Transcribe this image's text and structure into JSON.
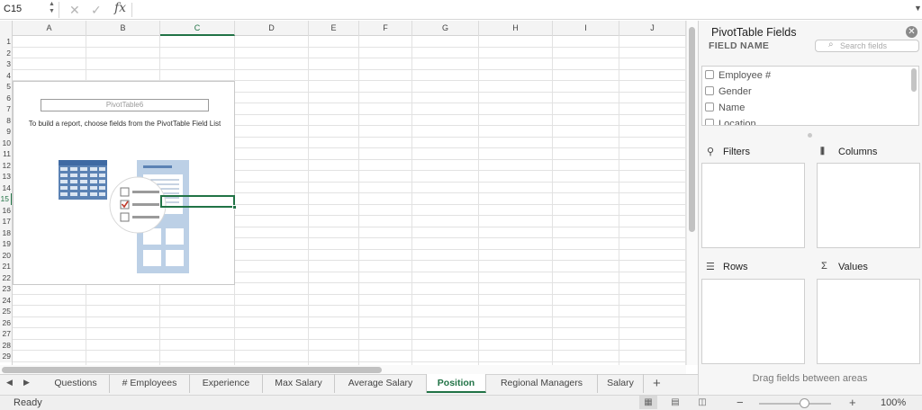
{
  "formula_bar": {
    "name_box": "C15",
    "fx": "fx"
  },
  "grid": {
    "columns": [
      "A",
      "B",
      "C",
      "D",
      "E",
      "F",
      "G",
      "H",
      "I",
      "J"
    ],
    "active_column": "C",
    "rows": [
      "1",
      "2",
      "3",
      "4",
      "5",
      "6",
      "7",
      "8",
      "9",
      "10",
      "11",
      "12",
      "13",
      "14",
      "15",
      "16",
      "17",
      "18",
      "19",
      "20",
      "21",
      "22",
      "23",
      "24",
      "25",
      "26",
      "27",
      "28",
      "29"
    ],
    "active_row": "15"
  },
  "pivot_placeholder": {
    "name": "PivotTable6",
    "message": "To build a report, choose fields from the PivotTable Field List"
  },
  "sheet_tabs": [
    "Questions",
    "# Employees",
    "Experience",
    "Max Salary",
    "Average Salary",
    "Position",
    "Regional Managers",
    "Salary"
  ],
  "active_sheet": "Position",
  "status_bar": {
    "status": "Ready",
    "zoom": "100%",
    "zoom_percent": 100
  },
  "field_pane": {
    "title": "PivotTable Fields",
    "field_name_label": "FIELD NAME",
    "search_placeholder": "Search fields",
    "fields": [
      "Employee #",
      "Gender",
      "Name",
      "Location"
    ],
    "areas": {
      "filters": "Filters",
      "columns": "Columns",
      "rows": "Rows",
      "values": "Values"
    },
    "drag_hint": "Drag fields between areas"
  },
  "colors": {
    "accent": "#217346",
    "grid_line": "#e2e2e2",
    "illustration_blue": "#5b82b4"
  }
}
